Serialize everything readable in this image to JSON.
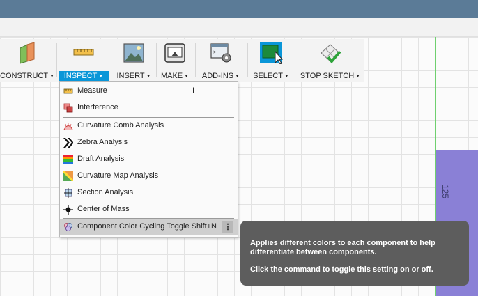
{
  "toolbar": {
    "groups": [
      {
        "label": "CONSTRUCT",
        "icon": "construct-plane-icon"
      },
      {
        "label": "INSPECT",
        "icon": "ruler-measure-icon"
      },
      {
        "label": "INSERT",
        "icon": "insert-image-icon"
      },
      {
        "label": "MAKE",
        "icon": "3d-printer-icon"
      },
      {
        "label": "ADD-INS",
        "icon": "add-ins-script-icon"
      },
      {
        "label": "SELECT",
        "icon": "select-window-icon"
      },
      {
        "label": "STOP SKETCH",
        "icon": "stop-sketch-check-icon"
      }
    ],
    "dropdown_arrow": "▼"
  },
  "inspect_menu": {
    "items": [
      {
        "label": "Measure",
        "shortcut": "I",
        "icon": "ruler-icon"
      },
      {
        "label": "Interference",
        "shortcut": "",
        "icon": "interference-icon"
      },
      {
        "label": "Curvature Comb Analysis",
        "shortcut": "",
        "icon": "curvature-comb-icon"
      },
      {
        "label": "Zebra Analysis",
        "shortcut": "",
        "icon": "zebra-icon"
      },
      {
        "label": "Draft Analysis",
        "shortcut": "",
        "icon": "draft-analysis-icon"
      },
      {
        "label": "Curvature Map Analysis",
        "shortcut": "",
        "icon": "curvature-map-icon"
      },
      {
        "label": "Section Analysis",
        "shortcut": "",
        "icon": "section-analysis-icon"
      },
      {
        "label": "Center of Mass",
        "shortcut": "",
        "icon": "center-of-mass-icon"
      },
      {
        "label": "Component Color Cycling Toggle",
        "shortcut": "Shift+N",
        "icon": "color-cycling-icon"
      }
    ],
    "more_glyph": "⋮"
  },
  "tooltip": {
    "line1": "Applies different colors to each component to help differentiate between components.",
    "line2": "Click the command to toggle this setting on or off."
  },
  "canvas": {
    "dimension_label": "125"
  },
  "colors": {
    "accent": "#0a96d8",
    "titlebar": "#5b7b97",
    "sketch_fill": "#8a80d6",
    "axis_green": "#6fd06f"
  }
}
